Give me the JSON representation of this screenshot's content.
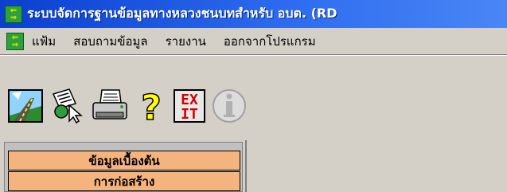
{
  "window": {
    "title": "ระบบจัดการฐานข้อมูลทางหลวงชนบทสำหรับ อบต. (RD"
  },
  "menubar": {
    "items": [
      {
        "label": "แฟ้ม"
      },
      {
        "label": "สอบถามข้อมูล"
      },
      {
        "label": "รายงาน"
      },
      {
        "label": "ออกจากโปรแกรม"
      }
    ]
  },
  "toolbar": {
    "buttons": [
      {
        "icon": "road-map-icon"
      },
      {
        "icon": "search-documents-icon"
      },
      {
        "icon": "printer-icon"
      },
      {
        "icon": "help-icon"
      },
      {
        "icon": "exit-icon",
        "text_line1": "EX",
        "text_line2": "IT"
      },
      {
        "icon": "info-icon"
      }
    ]
  },
  "sidepanel": {
    "items": [
      {
        "label": "ข้อมูลเบื้องต้น"
      },
      {
        "label": "การก่อสร้าง"
      }
    ]
  },
  "colors": {
    "titlebar": "#0a3fd0",
    "side_button": "#f5b37e",
    "background": "#d4d0c8"
  }
}
